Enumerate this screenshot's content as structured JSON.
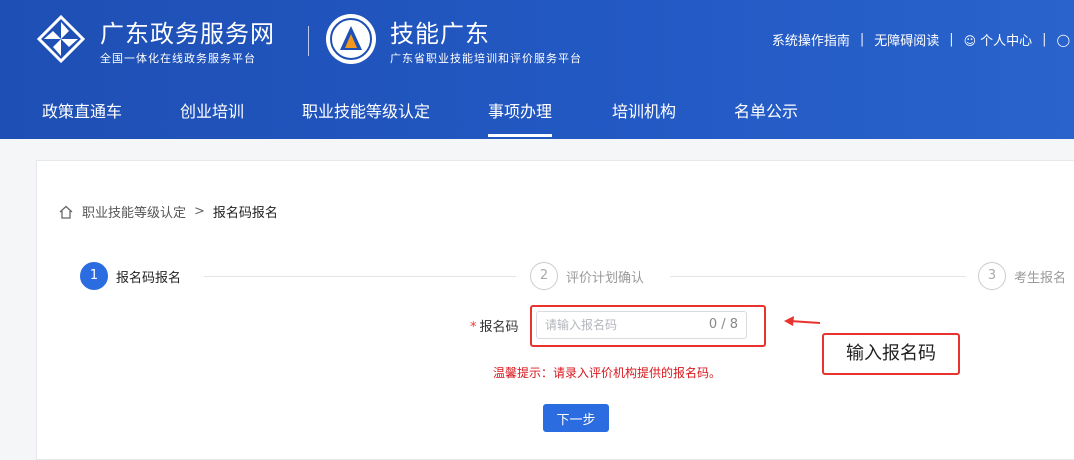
{
  "header": {
    "site_title": "广东政务服务网",
    "site_subtitle": "全国一体化在线政务服务平台",
    "skill_title": "技能广东",
    "skill_subtitle": "广东省职业技能培训和评价服务平台",
    "links": {
      "guide": "系统操作指南",
      "accessible": "无障碍阅读",
      "personal": "个人中心"
    }
  },
  "nav": {
    "items": [
      "政策直通车",
      "创业培训",
      "职业技能等级认定",
      "事项办理",
      "培训机构",
      "名单公示"
    ],
    "active_index": 3
  },
  "breadcrumb": {
    "parent": "职业技能等级认定",
    "separator": ">",
    "current": "报名码报名"
  },
  "steps": [
    {
      "num": "1",
      "label": "报名码报名",
      "state": "active"
    },
    {
      "num": "2",
      "label": "评价计划确认",
      "state": "idle"
    },
    {
      "num": "3",
      "label": "考生报名",
      "state": "idle"
    }
  ],
  "form": {
    "required_mark": "*",
    "label": "报名码",
    "placeholder": "请输入报名码",
    "value": "",
    "counter": "0 / 8",
    "hint": "温馨提示：请录入评价机构提供的报名码。",
    "next_button": "下一步"
  },
  "annotation": {
    "callout_text": "输入报名码",
    "color": "#e8332e"
  },
  "colors": {
    "header_blue": "#2359c4",
    "primary": "#2b6de0",
    "hint_red": "#d9161c"
  }
}
